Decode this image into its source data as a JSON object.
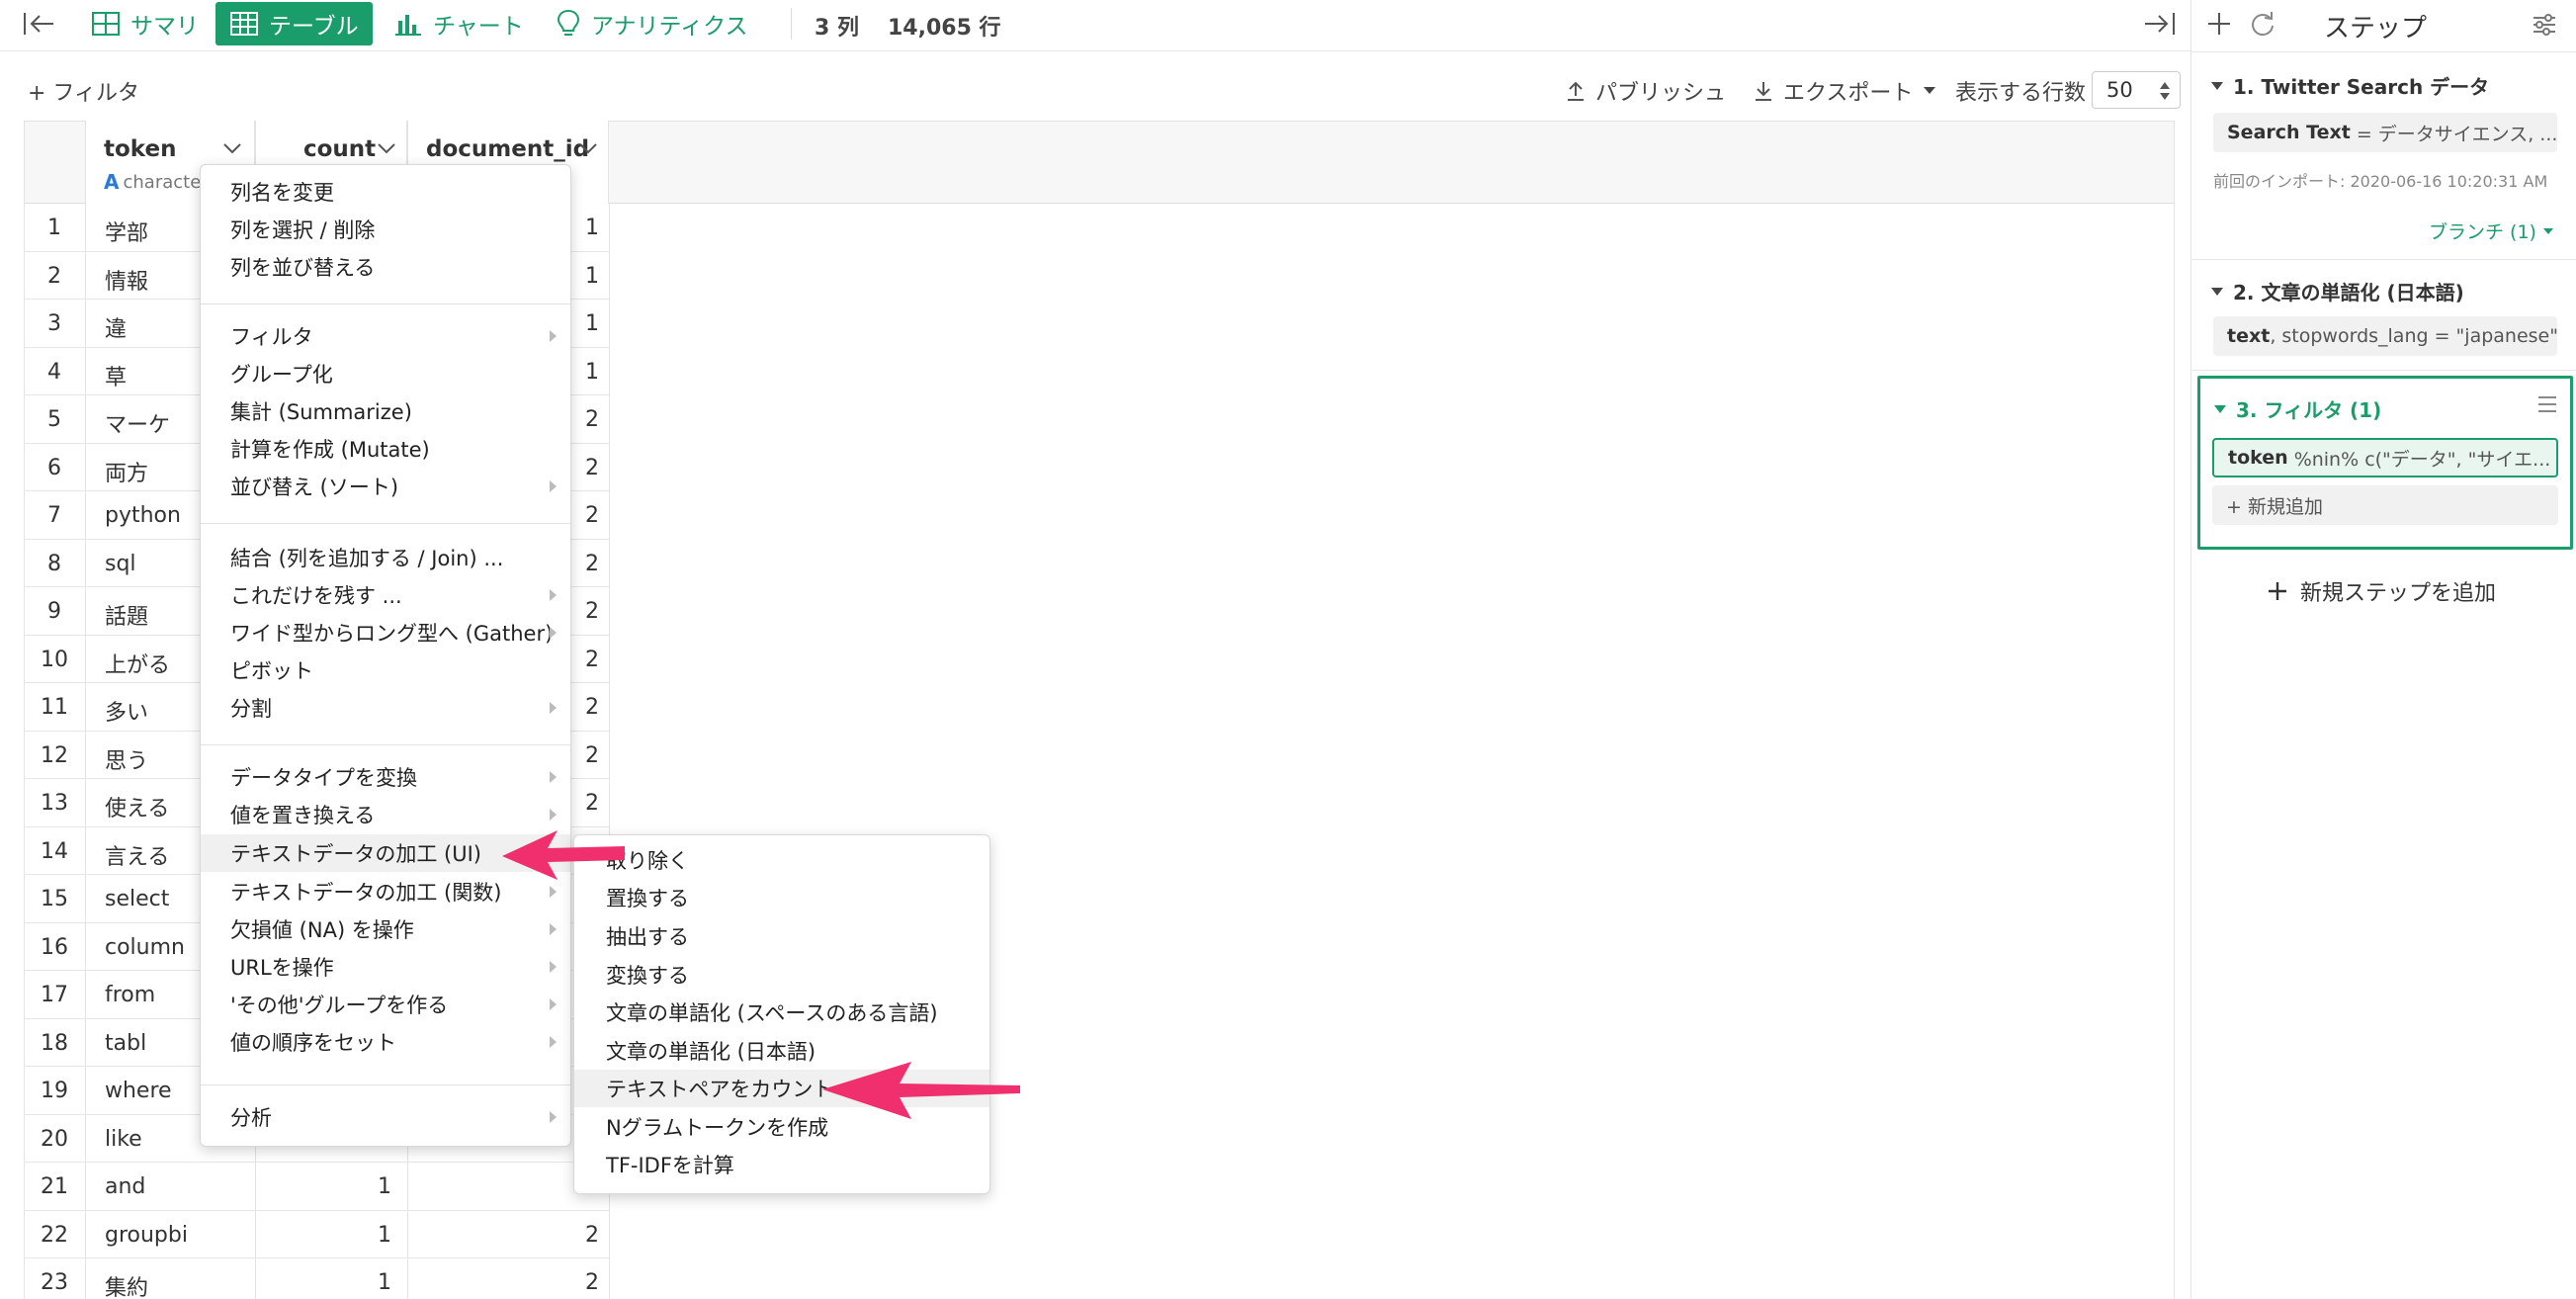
{
  "topbar": {
    "tabs": [
      {
        "label": "サマリ",
        "icon": "summary-grid-icon"
      },
      {
        "label": "テーブル",
        "icon": "table-icon",
        "active": true
      },
      {
        "label": "チャート",
        "icon": "bar-chart-icon"
      },
      {
        "label": "アナリティクス",
        "icon": "lightbulb-icon"
      }
    ],
    "columns_count": "3 列",
    "rows_count": "14,065 行"
  },
  "toolbar": {
    "filter_label": "+ フィルタ",
    "publish_label": "パブリッシュ",
    "export_label": "エクスポート",
    "rows_display_label": "表示する行数",
    "rows_display_value": "50"
  },
  "table": {
    "columns": [
      {
        "name": "token",
        "type": "character"
      },
      {
        "name": "count",
        "type": ""
      },
      {
        "name": "document_id",
        "type": ""
      }
    ],
    "rows": [
      {
        "n": "1",
        "token": "学部",
        "count": "",
        "doc": "1"
      },
      {
        "n": "2",
        "token": "情報",
        "count": "",
        "doc": "1"
      },
      {
        "n": "3",
        "token": "違",
        "count": "",
        "doc": "1"
      },
      {
        "n": "4",
        "token": "草",
        "count": "",
        "doc": "1"
      },
      {
        "n": "5",
        "token": "マーケ",
        "count": "",
        "doc": "2"
      },
      {
        "n": "6",
        "token": "両方",
        "count": "",
        "doc": "2"
      },
      {
        "n": "7",
        "token": "python",
        "count": "",
        "doc": "2"
      },
      {
        "n": "8",
        "token": "sql",
        "count": "",
        "doc": "2"
      },
      {
        "n": "9",
        "token": "話題",
        "count": "",
        "doc": "2"
      },
      {
        "n": "10",
        "token": "上がる",
        "count": "",
        "doc": "2"
      },
      {
        "n": "11",
        "token": "多い",
        "count": "",
        "doc": "2"
      },
      {
        "n": "12",
        "token": "思う",
        "count": "",
        "doc": "2"
      },
      {
        "n": "13",
        "token": "使える",
        "count": "",
        "doc": "2"
      },
      {
        "n": "14",
        "token": "言える",
        "count": "",
        "doc": ""
      },
      {
        "n": "15",
        "token": "select",
        "count": "",
        "doc": ""
      },
      {
        "n": "16",
        "token": "column",
        "count": "",
        "doc": ""
      },
      {
        "n": "17",
        "token": "from",
        "count": "",
        "doc": ""
      },
      {
        "n": "18",
        "token": "tabl",
        "count": "",
        "doc": ""
      },
      {
        "n": "19",
        "token": "where",
        "count": "",
        "doc": ""
      },
      {
        "n": "20",
        "token": "like",
        "count": "",
        "doc": ""
      },
      {
        "n": "21",
        "token": "and",
        "count": "1",
        "doc": ""
      },
      {
        "n": "22",
        "token": "groupbi",
        "count": "1",
        "doc": "2"
      },
      {
        "n": "23",
        "token": "集約",
        "count": "1",
        "doc": "2"
      }
    ]
  },
  "menu": {
    "items": [
      "列名を変更",
      "列を選択 / 削除",
      "列を並び替える",
      "フィルタ",
      "グループ化",
      "集計 (Summarize)",
      "計算を作成 (Mutate)",
      "並び替え (ソート)",
      "結合 (列を追加する / Join) ...",
      "これだけを残す ...",
      "ワイド型からロング型へ (Gather)",
      "ピボット",
      "分割",
      "データタイプを変換",
      "値を置き換える",
      "テキストデータの加工 (UI)",
      "テキストデータの加工 (関数)",
      "欠損値 (NA) を操作",
      "URLを操作",
      "'その他'グループを作る",
      "値の順序をセット",
      "分析"
    ]
  },
  "submenu": {
    "items": [
      "取り除く",
      "置換する",
      "抽出する",
      "変換する",
      "文章の単語化 (スペースのある言語)",
      "文章の単語化 (日本語)",
      "テキストペアをカウント",
      "Nグラムトークンを作成",
      "TF-IDFを計算"
    ]
  },
  "panel": {
    "title": "ステップ",
    "step1": {
      "title": "1. Twitter Search データ",
      "param_key": "Search Text",
      "param_val": "= データサイエンス, ...",
      "last_import": "前回のインポート: 2020-06-16 10:20:31 AM",
      "branch": "ブランチ (1)"
    },
    "step2": {
      "title": "2. 文章の単語化 (日本語)",
      "param_key": "text",
      "param_val": ", stopwords_lang = \"japanese\""
    },
    "step3": {
      "title": "3. フィルタ (1)",
      "param_key": "token",
      "param_val": "%nin% c(\"データ\", \"サイエ...",
      "add_new": "+ 新規追加"
    },
    "add_step": "新規ステップを追加"
  },
  "colors": {
    "accent": "#1a9c6b",
    "arrow": "#f0306e"
  }
}
